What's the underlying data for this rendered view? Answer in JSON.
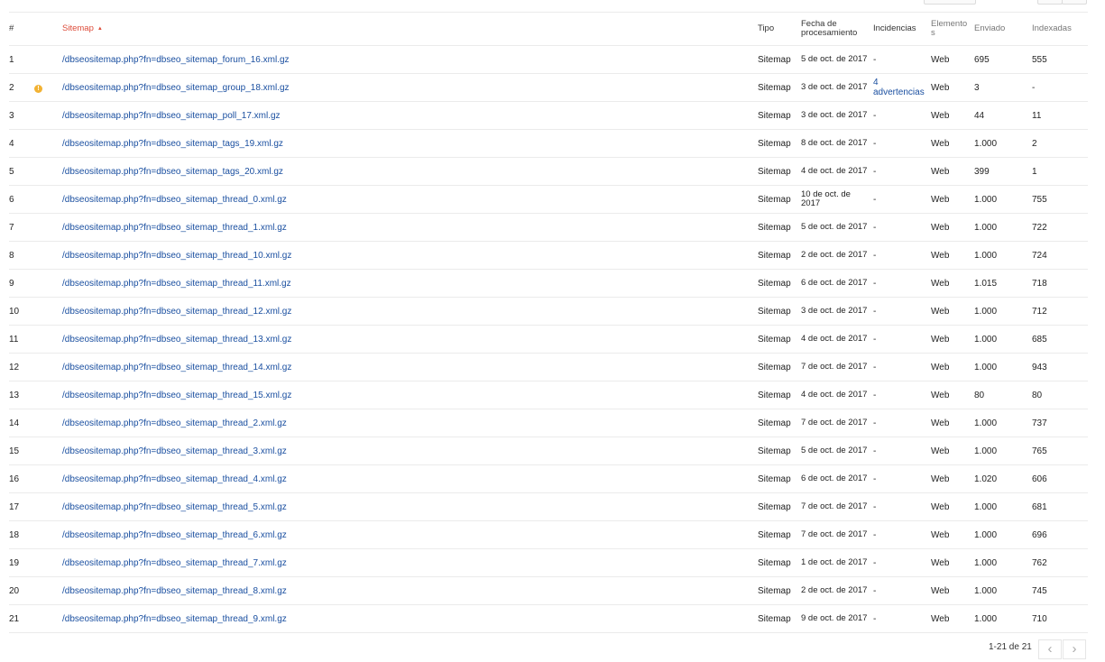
{
  "table": {
    "headers": {
      "num": "#",
      "sitemap": "Sitemap",
      "tipo": "Tipo",
      "fecha_l1": "Fecha de",
      "fecha_l2": "procesamiento",
      "incidencias": "Incidencias",
      "elementos_l1": "Elemento",
      "elementos_l2": "s",
      "enviado": "Enviado",
      "indexadas": "Indexadas"
    },
    "sort_indicator": "ascending",
    "rows": [
      {
        "num": "1",
        "warning": false,
        "path": "/dbseositemap.php?fn=dbseo_sitemap_forum_16.xml.gz",
        "tipo": "Sitemap",
        "fecha": "5 de oct. de 2017",
        "incidencias": "-",
        "elementos": "Web",
        "enviado": "695",
        "indexadas": "555"
      },
      {
        "num": "2",
        "warning": true,
        "path": "/dbseositemap.php?fn=dbseo_sitemap_group_18.xml.gz",
        "tipo": "Sitemap",
        "fecha": "3 de oct. de 2017",
        "incidencias": "4 advertencias",
        "elementos": "Web",
        "enviado": "3",
        "indexadas": "-"
      },
      {
        "num": "3",
        "warning": false,
        "path": "/dbseositemap.php?fn=dbseo_sitemap_poll_17.xml.gz",
        "tipo": "Sitemap",
        "fecha": "3 de oct. de 2017",
        "incidencias": "-",
        "elementos": "Web",
        "enviado": "44",
        "indexadas": "11"
      },
      {
        "num": "4",
        "warning": false,
        "path": "/dbseositemap.php?fn=dbseo_sitemap_tags_19.xml.gz",
        "tipo": "Sitemap",
        "fecha": "8 de oct. de 2017",
        "incidencias": "-",
        "elementos": "Web",
        "enviado": "1.000",
        "indexadas": "2"
      },
      {
        "num": "5",
        "warning": false,
        "path": "/dbseositemap.php?fn=dbseo_sitemap_tags_20.xml.gz",
        "tipo": "Sitemap",
        "fecha": "4 de oct. de 2017",
        "incidencias": "-",
        "elementos": "Web",
        "enviado": "399",
        "indexadas": "1"
      },
      {
        "num": "6",
        "warning": false,
        "path": "/dbseositemap.php?fn=dbseo_sitemap_thread_0.xml.gz",
        "tipo": "Sitemap",
        "fecha": "10 de oct. de 2017",
        "incidencias": "-",
        "elementos": "Web",
        "enviado": "1.000",
        "indexadas": "755"
      },
      {
        "num": "7",
        "warning": false,
        "path": "/dbseositemap.php?fn=dbseo_sitemap_thread_1.xml.gz",
        "tipo": "Sitemap",
        "fecha": "5 de oct. de 2017",
        "incidencias": "-",
        "elementos": "Web",
        "enviado": "1.000",
        "indexadas": "722"
      },
      {
        "num": "8",
        "warning": false,
        "path": "/dbseositemap.php?fn=dbseo_sitemap_thread_10.xml.gz",
        "tipo": "Sitemap",
        "fecha": "2 de oct. de 2017",
        "incidencias": "-",
        "elementos": "Web",
        "enviado": "1.000",
        "indexadas": "724"
      },
      {
        "num": "9",
        "warning": false,
        "path": "/dbseositemap.php?fn=dbseo_sitemap_thread_11.xml.gz",
        "tipo": "Sitemap",
        "fecha": "6 de oct. de 2017",
        "incidencias": "-",
        "elementos": "Web",
        "enviado": "1.015",
        "indexadas": "718"
      },
      {
        "num": "10",
        "warning": false,
        "path": "/dbseositemap.php?fn=dbseo_sitemap_thread_12.xml.gz",
        "tipo": "Sitemap",
        "fecha": "3 de oct. de 2017",
        "incidencias": "-",
        "elementos": "Web",
        "enviado": "1.000",
        "indexadas": "712"
      },
      {
        "num": "11",
        "warning": false,
        "path": "/dbseositemap.php?fn=dbseo_sitemap_thread_13.xml.gz",
        "tipo": "Sitemap",
        "fecha": "4 de oct. de 2017",
        "incidencias": "-",
        "elementos": "Web",
        "enviado": "1.000",
        "indexadas": "685"
      },
      {
        "num": "12",
        "warning": false,
        "path": "/dbseositemap.php?fn=dbseo_sitemap_thread_14.xml.gz",
        "tipo": "Sitemap",
        "fecha": "7 de oct. de 2017",
        "incidencias": "-",
        "elementos": "Web",
        "enviado": "1.000",
        "indexadas": "943"
      },
      {
        "num": "13",
        "warning": false,
        "path": "/dbseositemap.php?fn=dbseo_sitemap_thread_15.xml.gz",
        "tipo": "Sitemap",
        "fecha": "4 de oct. de 2017",
        "incidencias": "-",
        "elementos": "Web",
        "enviado": "80",
        "indexadas": "80"
      },
      {
        "num": "14",
        "warning": false,
        "path": "/dbseositemap.php?fn=dbseo_sitemap_thread_2.xml.gz",
        "tipo": "Sitemap",
        "fecha": "7 de oct. de 2017",
        "incidencias": "-",
        "elementos": "Web",
        "enviado": "1.000",
        "indexadas": "737"
      },
      {
        "num": "15",
        "warning": false,
        "path": "/dbseositemap.php?fn=dbseo_sitemap_thread_3.xml.gz",
        "tipo": "Sitemap",
        "fecha": "5 de oct. de 2017",
        "incidencias": "-",
        "elementos": "Web",
        "enviado": "1.000",
        "indexadas": "765"
      },
      {
        "num": "16",
        "warning": false,
        "path": "/dbseositemap.php?fn=dbseo_sitemap_thread_4.xml.gz",
        "tipo": "Sitemap",
        "fecha": "6 de oct. de 2017",
        "incidencias": "-",
        "elementos": "Web",
        "enviado": "1.020",
        "indexadas": "606"
      },
      {
        "num": "17",
        "warning": false,
        "path": "/dbseositemap.php?fn=dbseo_sitemap_thread_5.xml.gz",
        "tipo": "Sitemap",
        "fecha": "7 de oct. de 2017",
        "incidencias": "-",
        "elementos": "Web",
        "enviado": "1.000",
        "indexadas": "681"
      },
      {
        "num": "18",
        "warning": false,
        "path": "/dbseositemap.php?fn=dbseo_sitemap_thread_6.xml.gz",
        "tipo": "Sitemap",
        "fecha": "7 de oct. de 2017",
        "incidencias": "-",
        "elementos": "Web",
        "enviado": "1.000",
        "indexadas": "696"
      },
      {
        "num": "19",
        "warning": false,
        "path": "/dbseositemap.php?fn=dbseo_sitemap_thread_7.xml.gz",
        "tipo": "Sitemap",
        "fecha": "1 de oct. de 2017",
        "incidencias": "-",
        "elementos": "Web",
        "enviado": "1.000",
        "indexadas": "762"
      },
      {
        "num": "20",
        "warning": false,
        "path": "/dbseositemap.php?fn=dbseo_sitemap_thread_8.xml.gz",
        "tipo": "Sitemap",
        "fecha": "2 de oct. de 2017",
        "incidencias": "-",
        "elementos": "Web",
        "enviado": "1.000",
        "indexadas": "745"
      },
      {
        "num": "21",
        "warning": false,
        "path": "/dbseositemap.php?fn=dbseo_sitemap_thread_9.xml.gz",
        "tipo": "Sitemap",
        "fecha": "9 de oct. de 2017",
        "incidencias": "-",
        "elementos": "Web",
        "enviado": "1.000",
        "indexadas": "710"
      }
    ]
  },
  "pagination": {
    "range": "1-21 de 21",
    "prev_icon": "chevron-left-icon",
    "next_icon": "chevron-right-icon"
  },
  "colors": {
    "link": "#1a4fa0",
    "sorted_header": "#dd4b39",
    "warning": "#f2b233",
    "row_divider": "#ebebeb"
  }
}
